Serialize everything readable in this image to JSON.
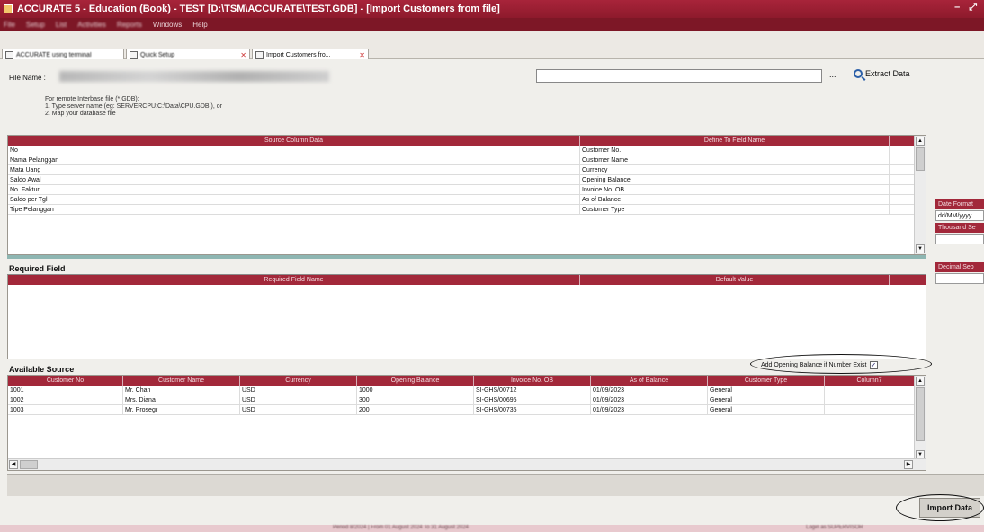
{
  "window": {
    "title": "ACCURATE 5 - Education (Book) - TEST   [D:\\TSM\\ACCURATE\\TEST.GDB] - [Import Customers from file]",
    "controls": [
      "–",
      "⤢"
    ]
  },
  "menu": [
    "File",
    "Setup",
    "List",
    "Activities",
    "Reports",
    "Windows",
    "Help"
  ],
  "tabs": [
    {
      "label": "ACCURATE using terminal"
    },
    {
      "label": "Quick Setup"
    },
    {
      "label": "Import Customers fro..."
    }
  ],
  "file": {
    "label": "File Name :",
    "browse": "...",
    "extract": "Extract Data"
  },
  "remote_note": "For remote Interbase file (*.GDB):\n1. Type server name (eg: SERVERCPU:C:\\Data\\CPU.GDB ), or\n2. Map your database file",
  "mapping": {
    "columns": [
      "Source Column Data",
      "Define To Field Name"
    ],
    "rows": [
      [
        "No",
        "Customer No."
      ],
      [
        "Nama Pelanggan",
        "Customer Name"
      ],
      [
        "Mata Uang",
        "Currency"
      ],
      [
        "Saldo Awal",
        "Opening Balance"
      ],
      [
        "No. Faktur",
        "Invoice No. OB"
      ],
      [
        "Saldo per Tgl",
        "As of Balance"
      ],
      [
        "Tipe Pelanggan",
        "Customer Type"
      ]
    ]
  },
  "required": {
    "title": "Required Field",
    "columns": [
      "Required Field Name",
      "Default Value"
    ]
  },
  "available": {
    "title": "Available Source",
    "add_opening_label": "Add Opening Balance if Number Exist",
    "add_opening_checked": "✓",
    "columns": [
      "Customer No",
      "Customer Name",
      "Currency",
      "Opening Balance",
      "Invoice No. OB",
      "As of Balance",
      "Customer Type",
      "Column7"
    ],
    "rows": [
      [
        "1001",
        "Mr. Chan",
        "USD",
        "1000",
        "SI-GHS/00712",
        "01/09/2023",
        "General",
        ""
      ],
      [
        "1002",
        "Mrs. Diana",
        "USD",
        "300",
        "SI-GHS/00695",
        "01/09/2023",
        "General",
        ""
      ],
      [
        "1003",
        "Mr. Prosegr",
        "USD",
        "200",
        "SI-GHS/00735",
        "01/09/2023",
        "General",
        ""
      ]
    ]
  },
  "side": {
    "date_format_label": "Date Format",
    "date_format_value": "dd/MM/yyyy",
    "thousand_label": "Thousand Se",
    "decimal_label": "Decimal Sep"
  },
  "import_button": "Import Data",
  "status": {
    "period": "Period 8/2024 | From 01 August 2024 To 31 August 2024",
    "login": "Login as SUPERVISOR"
  },
  "colors": {
    "title_bar": "#8e1a2c",
    "grid_header": "#a2283a"
  }
}
